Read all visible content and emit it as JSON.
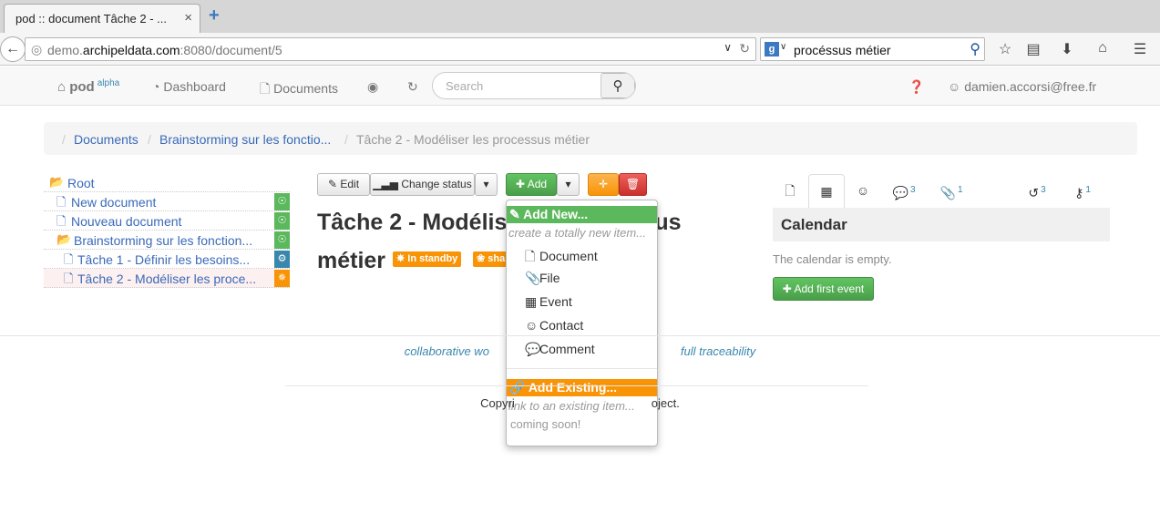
{
  "browser": {
    "tab_title": "pod :: document Tâche 2 - ...",
    "tab_close": "×",
    "new_tab": "+",
    "url_host": "demo.",
    "url_domain": "archipeldata.com",
    "url_rest": ":8080/document/5",
    "search_engine": "g",
    "search_text": "procéssus métier",
    "icons": [
      "back-icon",
      "globe-icon",
      "reload-icon",
      "star-icon",
      "reading-list-icon",
      "download-icon",
      "home-icon",
      "menu-icon"
    ]
  },
  "appnav": {
    "brand": "pod",
    "brand_sup": "alpha",
    "dashboard": "Dashboard",
    "documents": "Documents",
    "search_placeholder": "Search",
    "user": "damien.accorsi@free.fr"
  },
  "breadcrumb": {
    "items": [
      "Documents",
      "Brainstorming sur les fonctio...",
      "Tâche 2 - Modéliser les processus métier"
    ],
    "separator": "/"
  },
  "tree": [
    {
      "label": "Root",
      "icon": "folder-open-icon"
    },
    {
      "label": "New document",
      "icon": "document-icon",
      "status": "lightbulb"
    },
    {
      "label": "Nouveau document",
      "icon": "document-icon",
      "status": "lightbulb"
    },
    {
      "label": "Brainstorming sur les fonction...",
      "icon": "folder-open-icon",
      "status": "lightbulb"
    },
    {
      "label": "Tâche 1 - Définir les besoins...",
      "icon": "document-icon",
      "status": "gears"
    },
    {
      "label": "Tâche 2 - Modéliser les proce...",
      "icon": "document-icon",
      "status": "spinner"
    }
  ],
  "toolbar": {
    "edit": "Edit",
    "change_status": "Change status",
    "add": "Add"
  },
  "document": {
    "title_line1": "Tâche 2 - Modélis",
    "title_line1_end": "us",
    "title_line2": "métier",
    "status_badge": "In standby",
    "share_badge": "sha"
  },
  "add_menu": {
    "add_new": "Add New...",
    "add_new_hint": "create a totally new item...",
    "items": [
      "Document",
      "File",
      "Event",
      "Contact",
      "Comment"
    ],
    "add_existing": "Add Existing...",
    "add_existing_hint": "link to an existing item...",
    "coming_soon": "coming soon!"
  },
  "right_panel": {
    "tabs": [
      {
        "icon": "document-icon",
        "count": ""
      },
      {
        "icon": "calendar-icon",
        "count": ""
      },
      {
        "icon": "user-icon",
        "count": ""
      },
      {
        "icon": "comments-icon",
        "count": "3"
      },
      {
        "icon": "paperclip-icon",
        "count": "1"
      },
      {
        "icon": "history-icon",
        "count": "3"
      },
      {
        "icon": "key-icon",
        "count": "1"
      }
    ],
    "heading": "Calendar",
    "empty_text": "The calendar is empty.",
    "add_button": "Add first event"
  },
  "footer": {
    "tagline_left": "collaborative wo",
    "tagline_right": "full traceability",
    "copyright_left": "Copyri",
    "copyright_right": "oject."
  },
  "colors": {
    "link": "#3a6ab8",
    "green": "#5cb85c",
    "orange": "#f89406",
    "red": "#d9534f",
    "info": "#3a87ad"
  }
}
